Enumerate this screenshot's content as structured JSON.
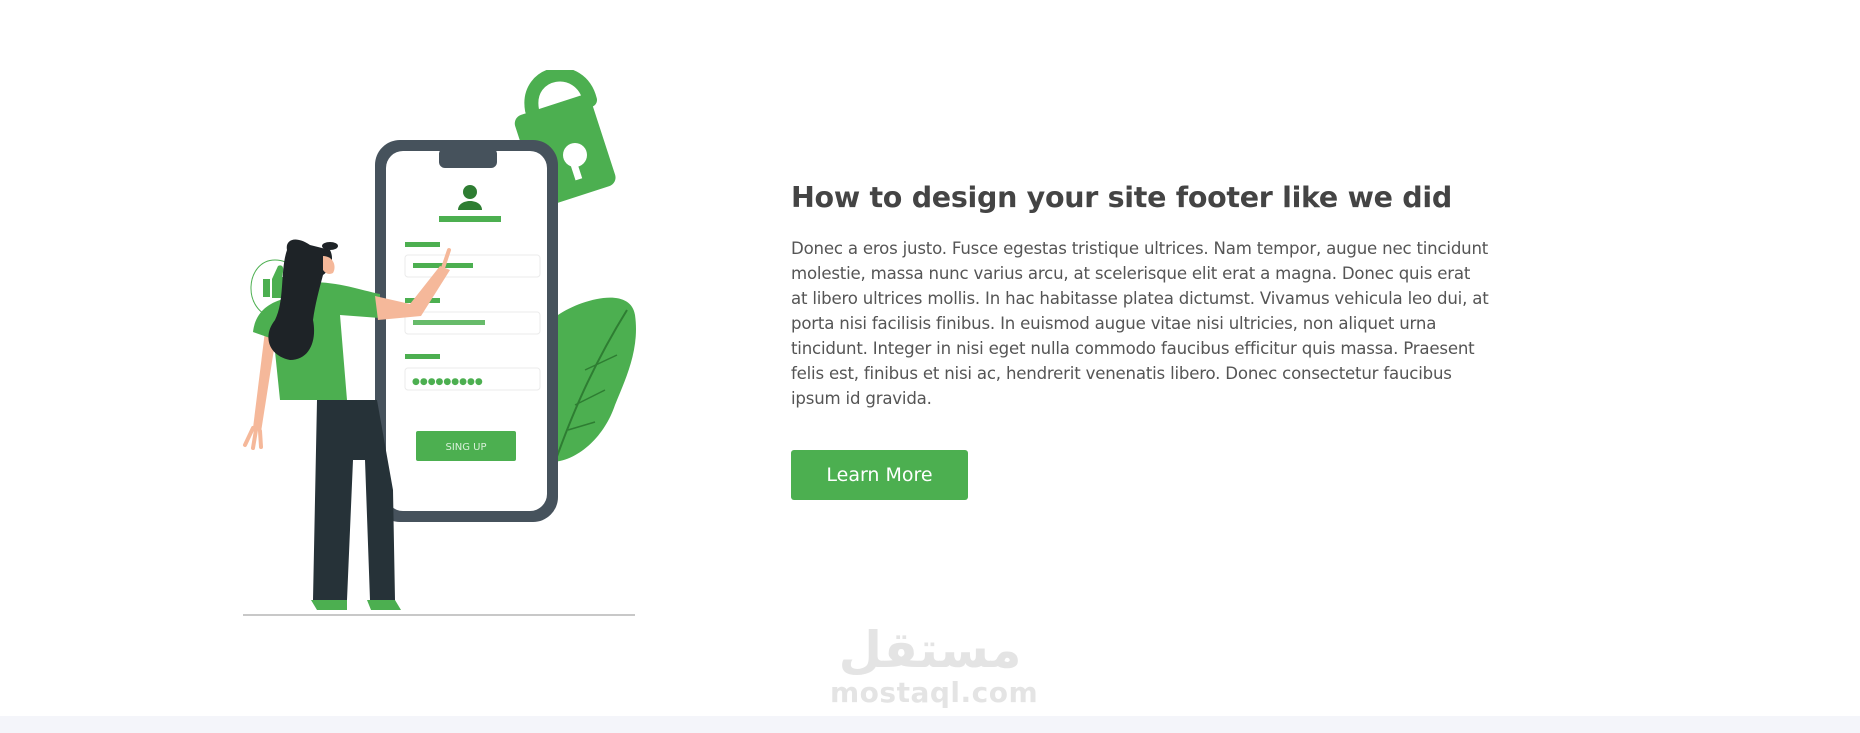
{
  "colors": {
    "accent": "#4caf50",
    "title": "#444444",
    "body_text": "#555555",
    "phone_frame": "#46525c",
    "figure_hair": "#1e2327",
    "skin": "#f5b89a",
    "watermark": "#e4e4e4",
    "bottom_band": "#f4f5fa"
  },
  "illustration": {
    "phone_button_label": "SING UP",
    "password_dots": "●●●●●●●●●",
    "icons": [
      "lock-icon",
      "user-icon",
      "thumbs-up-icon",
      "leaf-decoration"
    ]
  },
  "section": {
    "title": "How to design your site footer like we did",
    "body": "Donec a eros justo. Fusce egestas tristique ultrices. Nam tempor, augue nec tincidunt molestie, massa nunc varius arcu, at scelerisque elit erat a magna. Donec quis erat at libero ultrices mollis. In hac habitasse platea dictumst. Vivamus vehicula leo dui, at porta nisi facilisis finibus. In euismod augue vitae nisi ultricies, non aliquet urna tincidunt. Integer in nisi eget nulla commodo faucibus efficitur quis massa. Praesent felis est, finibus et nisi ac, hendrerit venenatis libero. Donec consectetur faucibus ipsum id gravida.",
    "button_label": "Learn More"
  },
  "watermark": {
    "arabic": "مستقل",
    "latin": "mostaql.com"
  }
}
